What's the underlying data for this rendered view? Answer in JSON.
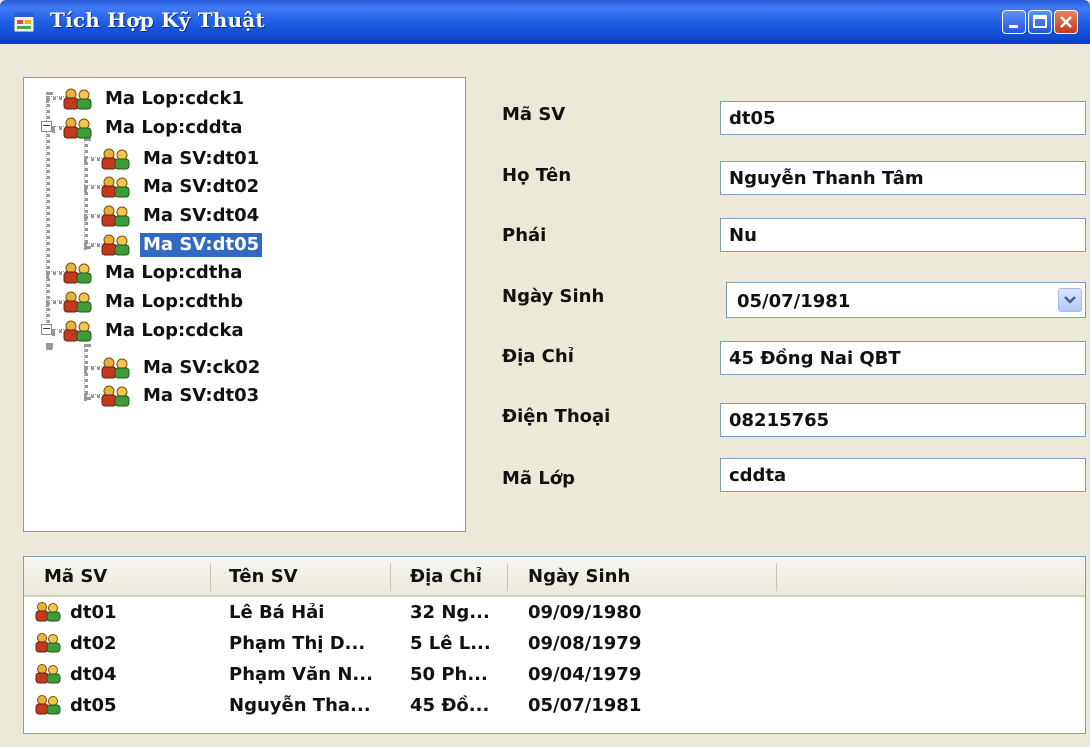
{
  "window": {
    "title": "Tích Hợp Kỹ Thuật"
  },
  "tree": {
    "nodes": [
      {
        "label": "Ma Lop:cdck1",
        "level": 0,
        "expanded": null
      },
      {
        "label": "Ma Lop:cddta",
        "level": 0,
        "expanded": true
      },
      {
        "label": "Ma SV:dt01",
        "level": 1
      },
      {
        "label": "Ma SV:dt02",
        "level": 1
      },
      {
        "label": "Ma SV:dt04",
        "level": 1
      },
      {
        "label": "Ma SV:dt05",
        "level": 1,
        "selected": true
      },
      {
        "label": "Ma Lop:cdtha",
        "level": 0,
        "expanded": null
      },
      {
        "label": "Ma Lop:cdthb",
        "level": 0,
        "expanded": null
      },
      {
        "label": "Ma Lop:cdcka",
        "level": 0,
        "expanded": true
      },
      {
        "label": "Ma SV:ck02",
        "level": 1
      },
      {
        "label": "Ma SV:dt03",
        "level": 1
      }
    ]
  },
  "form": {
    "ma_sv": {
      "label": "Mã SV",
      "value": "dt05"
    },
    "ho_ten": {
      "label": "Họ Tên",
      "value": "Nguyễn Thanh Tâm"
    },
    "phai": {
      "label": "Phái",
      "value": "Nu"
    },
    "ngay_sinh": {
      "label": "Ngày Sinh",
      "value": "05/07/1981"
    },
    "dia_chi": {
      "label": "Địa Chỉ",
      "value": "45 Đồng Nai QBT"
    },
    "dien_thoai": {
      "label": "Điện Thoại",
      "value": "08215765"
    },
    "ma_lop": {
      "label": "Mã Lớp",
      "value": "cddta"
    }
  },
  "grid": {
    "columns": [
      "Mã SV",
      "Tên SV",
      "Địa Chỉ",
      "Ngày Sinh"
    ],
    "rows": [
      [
        "dt01",
        "Lê Bá Hải",
        "32 Ng...",
        "09/09/1980"
      ],
      [
        "dt02",
        "Phạm Thị D...",
        "5 Lê L...",
        "09/08/1979"
      ],
      [
        "dt04",
        "Phạm Văn N...",
        "50 Ph...",
        "09/04/1979"
      ],
      [
        "dt05",
        "Nguyễn Tha...",
        "45 Đồ...",
        "05/07/1981"
      ]
    ]
  },
  "icons": {
    "app": "app-window-icon",
    "node": "users-icon",
    "dropdown": "chevron-down-icon",
    "minimize": "minimize-icon",
    "maximize": "maximize-icon",
    "close": "close-icon"
  },
  "colors": {
    "titlebar": "#1d5be3",
    "selection": "#316ac5",
    "window_bg": "#ece9d8"
  }
}
